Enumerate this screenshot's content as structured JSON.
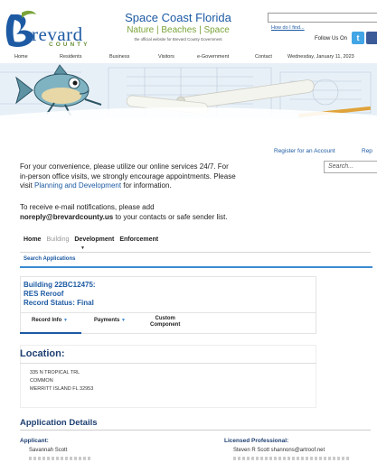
{
  "header": {
    "logo_word": "revard",
    "logo_county": "COUNTY",
    "title_line1": "Space Coast Florida",
    "title_line2": "Nature | Beaches | Space",
    "title_line3": "the official website for Brevard County Government",
    "how_do_i": "How do I find...",
    "follow_us": "Follow Us On"
  },
  "topnav": [
    "Home",
    "Residents",
    "Business",
    "Visitors",
    "e-Government",
    "Contact",
    "Wednesday, January 11, 2023"
  ],
  "account": {
    "register": "Register for an Account",
    "report": "Rep",
    "search_placeholder": "Search..."
  },
  "notices": {
    "line1": "For your convenience, please utilize our online services 24/7. For",
    "line2": "in-person office visits, we strongly encourage appointments. Please",
    "line3_pre": "visit ",
    "line3_link": "Planning and Development",
    "line3_post": " for information.",
    "email1": "To receive e-mail notifications, please add",
    "email2_bold": "noreply@brevardcounty.us",
    "email2_post": " to your contacts or safe sender list."
  },
  "modules": [
    {
      "label": "Home",
      "dim": false
    },
    {
      "label": "Building",
      "dim": true
    },
    {
      "label": "Development",
      "dim": false
    },
    {
      "label": "Enforcement",
      "dim": false
    }
  ],
  "subnav": "Search Applications",
  "record": {
    "number": "Building 22BC12475:",
    "type": "RES Reroof",
    "status": "Record Status: Final"
  },
  "record_tabs": {
    "info": "Record Info",
    "payments": "Payments",
    "custom1": "Custom",
    "custom2": "Component"
  },
  "location": {
    "heading": "Location:",
    "line1": "335 N TROPICAL TRL",
    "line2": "COMMON",
    "line3": "MERRITT ISLAND FL 32953"
  },
  "application": {
    "heading": "Application Details",
    "applicant_label": "Applicant:",
    "applicant_name": "Savannah Scott",
    "professional_label": "Licensed Professional:",
    "professional_name": "Steven R Scott shannons@artroof.net"
  },
  "colors": {
    "brand_blue": "#1d5aa3",
    "brand_green": "#7aa43a",
    "heading_navy": "#1d3f72",
    "accent_line": "#3b8bd0"
  }
}
